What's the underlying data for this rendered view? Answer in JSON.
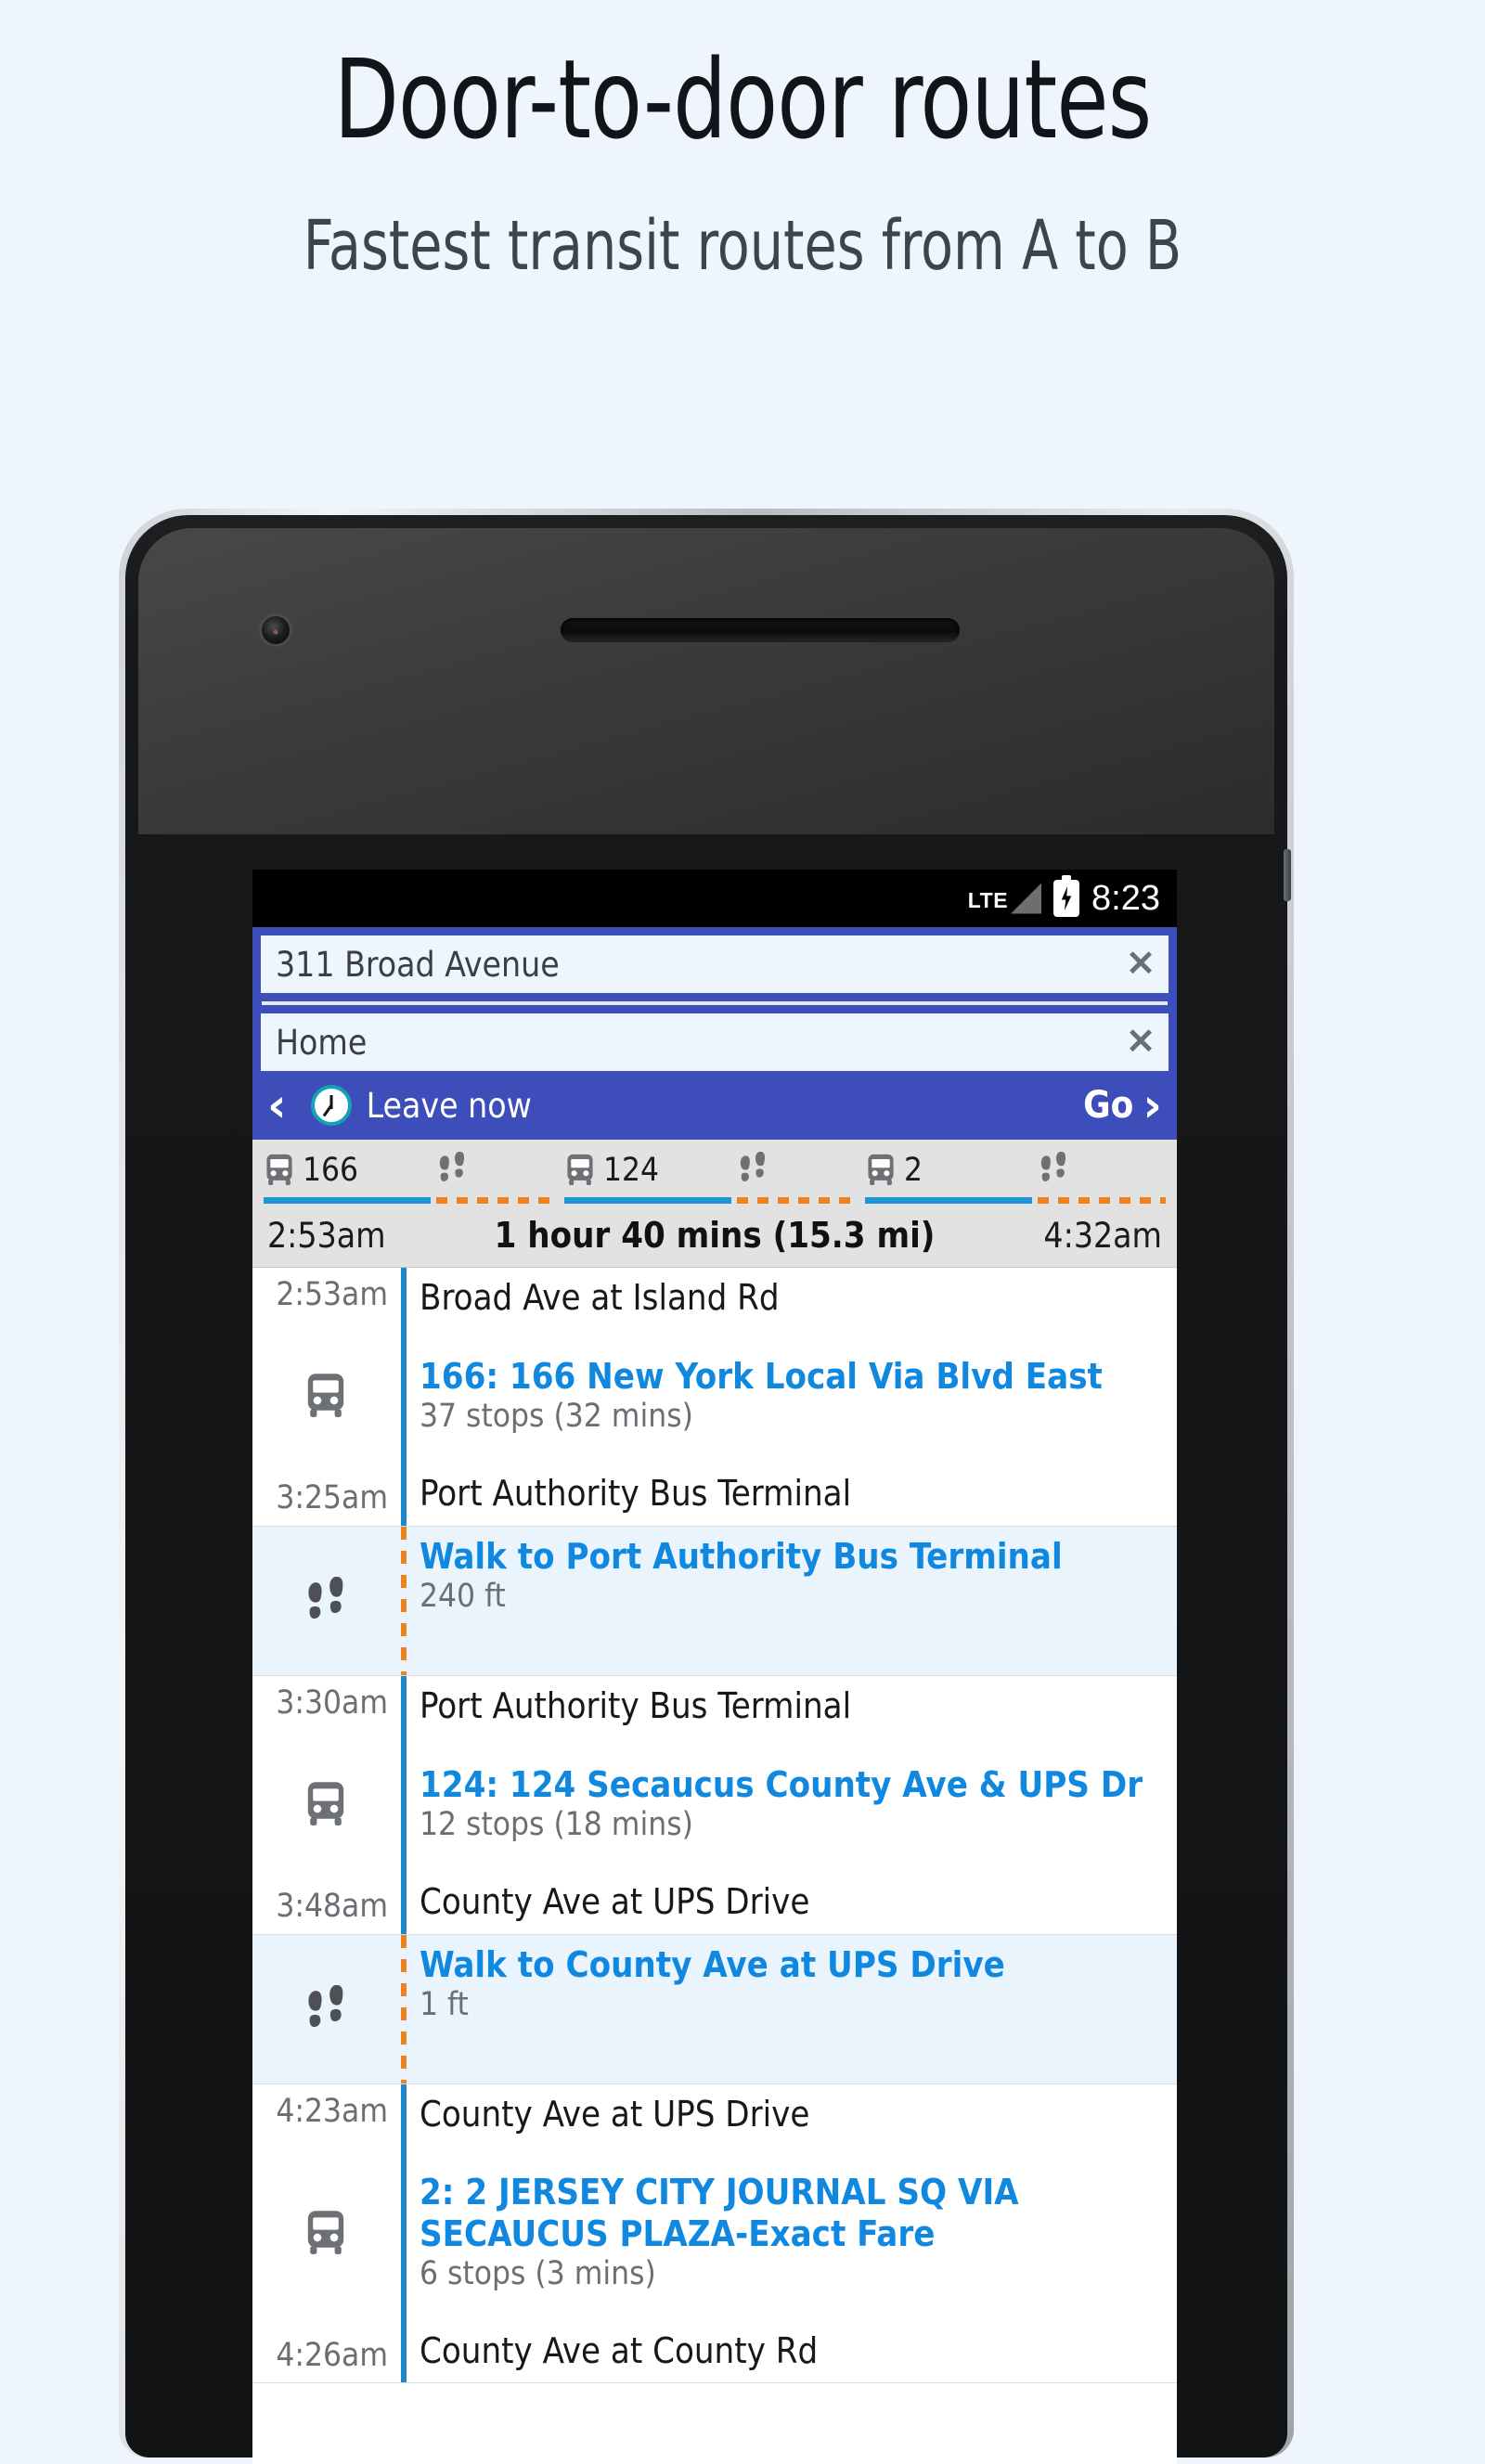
{
  "headline": {
    "title": "Door-to-door routes",
    "subtitle": "Fastest transit routes from A to B"
  },
  "status_bar": {
    "network": "LTE",
    "signal_icon": "signal-triangle-icon",
    "battery_icon": "battery-charging-icon",
    "time": "8:23"
  },
  "search": {
    "origin_value": "311 Broad Avenue",
    "origin_clear": "✕",
    "destination_value": "Home",
    "destination_clear": "✕"
  },
  "toolbar": {
    "back_chevron": "‹",
    "clock_icon": "clock-icon",
    "leave_label": "Leave now",
    "go_label": "Go",
    "forward_chevron": "›"
  },
  "summary": {
    "legs": [
      {
        "type": "ride",
        "icon": "bus-icon",
        "number": "166"
      },
      {
        "type": "walk",
        "icon": "footprints-icon",
        "number": ""
      },
      {
        "type": "ride",
        "icon": "bus-icon",
        "number": "124"
      },
      {
        "type": "walk",
        "icon": "footprints-icon",
        "number": ""
      },
      {
        "type": "ride",
        "icon": "bus-icon",
        "number": "2"
      },
      {
        "type": "walk",
        "icon": "footprints-icon",
        "number": ""
      }
    ],
    "depart_time": "2:53am",
    "total": "1 hour 40 mins (15.3 mi)",
    "arrive_time": "4:32am"
  },
  "itinerary": [
    {
      "type": "ride",
      "icon": "bus-icon",
      "start_time": "2:53am",
      "start_stop": "Broad Ave at Island Rd",
      "route_title": "166: 166 New York Local Via Blvd East",
      "route_sub": "37 stops (32 mins)",
      "end_time": "3:25am",
      "end_stop": "Port Authority Bus Terminal"
    },
    {
      "type": "walk",
      "icon": "footprints-icon",
      "route_title": "Walk to Port Authority Bus Terminal",
      "route_sub": "240 ft"
    },
    {
      "type": "ride",
      "icon": "bus-icon",
      "start_time": "3:30am",
      "start_stop": "Port Authority Bus Terminal",
      "route_title": "124: 124 Secaucus County Ave & UPS Dr",
      "route_sub": "12 stops (18 mins)",
      "end_time": "3:48am",
      "end_stop": "County Ave at UPS Drive"
    },
    {
      "type": "walk",
      "icon": "footprints-icon",
      "route_title": "Walk to County Ave at UPS Drive",
      "route_sub": "1 ft"
    },
    {
      "type": "ride",
      "icon": "bus-icon",
      "start_time": "4:23am",
      "start_stop": "County Ave at UPS Drive",
      "route_title": "2: 2 JERSEY CITY JOURNAL SQ VIA SECAUCUS PLAZA-Exact Fare",
      "route_sub": "6 stops (3 mins)",
      "end_time": "4:26am",
      "end_stop": "County Ave at County Rd"
    }
  ],
  "colors": {
    "page_background": "#eff5fc",
    "toolbar_blue": "#3d4dba",
    "link_blue": "#1188e0",
    "ride_bar": "#2196d6",
    "walk_dash": "#ee8222",
    "walk_row_bg": "#eaf4fd",
    "summary_bg": "#e2e2e2"
  }
}
